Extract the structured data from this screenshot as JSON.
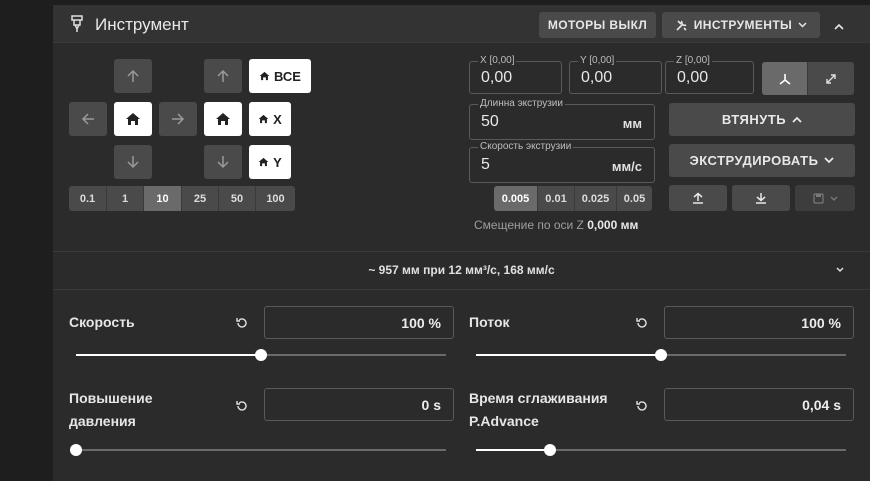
{
  "header": {
    "title": "Инструмент",
    "motors_off": "МОТОРЫ ВЫКЛ",
    "tools_menu": "ИНСТРУМЕНТЫ"
  },
  "jog": {
    "home_all": "ВСЕ",
    "home_x": "X",
    "home_y": "Y",
    "xy_steps": [
      "0.1",
      "1",
      "10",
      "25",
      "50",
      "100"
    ],
    "xy_active": "10",
    "z_steps": [
      "0.005",
      "0.01",
      "0.025",
      "0.05"
    ],
    "z_active": "0.005"
  },
  "position": {
    "x_label": "X [0,00]",
    "x_value": "0,00",
    "y_label": "Y [0,00]",
    "y_value": "0,00",
    "z_label": "Z [0,00]",
    "z_value": "0,00"
  },
  "extrusion": {
    "length_label": "Длинна экструзии",
    "length_value": "50",
    "length_unit": "мм",
    "speed_label": "Скорость экструзии",
    "speed_value": "5",
    "speed_unit": "мм/с",
    "retract_label": "ВТЯНУТЬ",
    "extrude_label": "ЭКСТРУДИРОВАТЬ"
  },
  "z_offset": {
    "label": "Смещение по оси Z",
    "value": "0,000 мм"
  },
  "summary": "~ 957 мм при 12 мм³/с, 168 мм/с",
  "tune": {
    "speed": {
      "label": "Скорость",
      "value": "100 %",
      "slider": 0.5
    },
    "flow": {
      "label": "Поток",
      "value": "100 %",
      "slider": 0.5
    },
    "pressure_advance": {
      "label_line1": "Повышение",
      "label_line2": "давления",
      "value": "0 s",
      "slider": 0.0
    },
    "smooth_time": {
      "label_line1": "Время сглаживания",
      "label_line2": "P.Advance",
      "value": "0,04 s",
      "slider": 0.2
    }
  },
  "colors": {
    "panel": "#2b2b2b",
    "header": "#333333",
    "button": "#4a4a4a",
    "accent": "#ffffff"
  }
}
